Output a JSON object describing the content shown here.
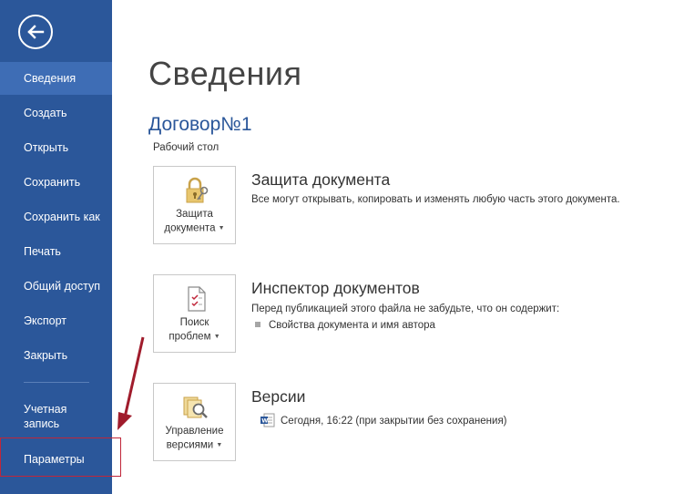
{
  "sidebar": {
    "items": [
      {
        "label": "Сведения",
        "active": true
      },
      {
        "label": "Создать"
      },
      {
        "label": "Открыть"
      },
      {
        "label": "Сохранить"
      },
      {
        "label": "Сохранить как"
      },
      {
        "label": "Печать"
      },
      {
        "label": "Общий доступ"
      },
      {
        "label": "Экспорт"
      },
      {
        "label": "Закрыть"
      }
    ],
    "account_line1": "Учетная",
    "account_line2": "запись",
    "options_label": "Параметры",
    "back_icon": "back-arrow-icon"
  },
  "main": {
    "title": "Сведения",
    "doc_name": "Договор№1",
    "doc_location": "Рабочий стол",
    "sections": [
      {
        "button_line1": "Защита",
        "button_line2": "документа",
        "icon": "lock-key-icon",
        "title": "Защита документа",
        "description": "Все могут открывать, копировать и изменять любую часть этого документа."
      },
      {
        "button_line1": "Поиск",
        "button_line2": "проблем",
        "icon": "inspect-document-icon",
        "title": "Инспектор документов",
        "description": "Перед публикацией этого файла не забудьте, что он содержит:",
        "bullets": [
          "Свойства документа и имя автора"
        ]
      },
      {
        "button_line1": "Управление",
        "button_line2": "версиями",
        "icon": "manage-versions-icon",
        "title": "Версии",
        "version_entry": "Сегодня, 16:22 (при закрытии без сохранения)"
      }
    ]
  },
  "colors": {
    "sidebar_bg": "#2b579a",
    "sidebar_active": "#3e6db5",
    "accent_red": "#c0263a"
  }
}
